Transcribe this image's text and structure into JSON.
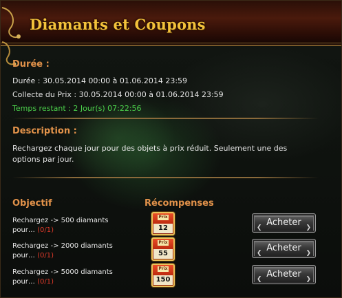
{
  "window": {
    "title": "Diamants et Coupons"
  },
  "duration": {
    "heading": "Durée :",
    "duree": "Durée : 30.05.2014 00:00 à 01.06.2014 23:59",
    "collecte": "Collecte du Prix : 30.05.2014 00:00 à 01.06.2014 23:59",
    "restant": "Temps restant : 2 Jour(s)  07:22:56"
  },
  "description": {
    "heading": "Description :",
    "text": "Rechargez chaque jour pour des objets à prix réduit. Seulement une des options par jour."
  },
  "rewards": {
    "col_objectif": "Objectif",
    "col_recompenses": "Récompenses",
    "rows": [
      {
        "line1": "Rechargez -> 500 diamants",
        "line2": "pour…",
        "count": "(0/1)",
        "coupon_label": "Prix",
        "coupon_value": "12",
        "button": "Acheter"
      },
      {
        "line1": "Rechargez -> 2000 diamants",
        "line2": "pour…",
        "count": "(0/1)",
        "coupon_label": "Prix",
        "coupon_value": "55",
        "button": "Acheter"
      },
      {
        "line1": "Rechargez -> 5000 diamants",
        "line2": "pour…",
        "count": "(0/1)",
        "coupon_label": "Prix",
        "coupon_value": "150",
        "button": "Acheter"
      }
    ]
  },
  "colors": {
    "title": "#f3c23b",
    "heading": "#e2924a",
    "remaining": "#4cd34c",
    "counter": "#e03a2a"
  }
}
